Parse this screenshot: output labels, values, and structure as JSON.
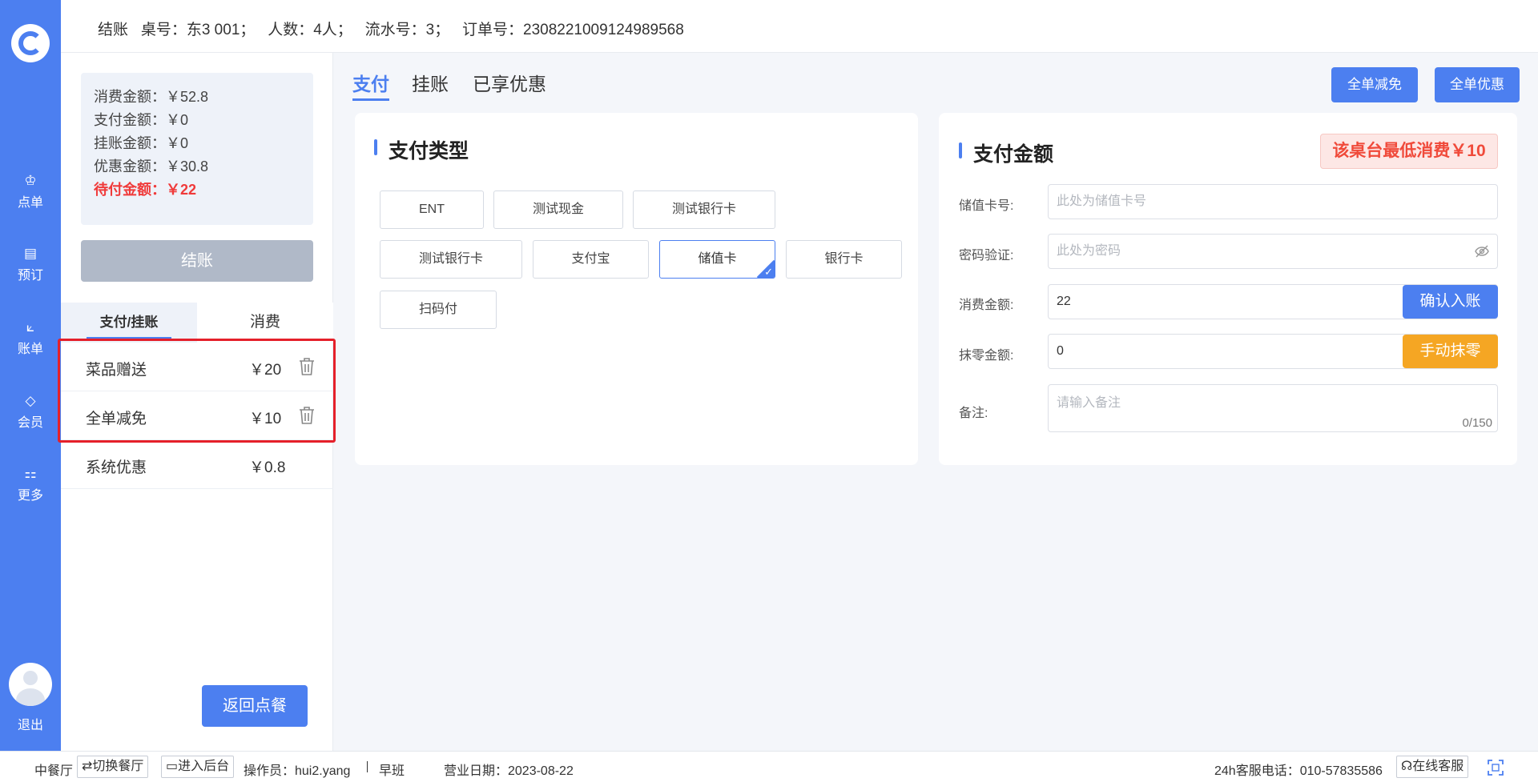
{
  "nav": {
    "items": [
      {
        "label": "点单",
        "icon": "chef-hat-icon",
        "glyph": "♔"
      },
      {
        "label": "预订",
        "icon": "booking-icon",
        "glyph": "▤"
      },
      {
        "label": "账单",
        "icon": "chart-icon",
        "glyph": "⟀"
      },
      {
        "label": "会员",
        "icon": "diamond-icon",
        "glyph": "◇"
      },
      {
        "label": "更多",
        "icon": "grid-icon",
        "glyph": "⚏"
      }
    ],
    "logout": "退出"
  },
  "header": {
    "text": "结账   桌号：东3 001；   人数：4人；   流水号：3；   订单号：2308221009124989568"
  },
  "summary": {
    "consume": "消费金额：￥52.8",
    "paid": "支付金额：￥0",
    "credit": "挂账金额：￥0",
    "discount": "优惠金额：￥30.8",
    "due": "待付金额：￥22"
  },
  "checkout_label": "结账",
  "left_tabs": {
    "pay": "支付/挂账",
    "consume": "消费"
  },
  "discounts": [
    {
      "name": "菜品赠送",
      "amount": "￥20"
    },
    {
      "name": "全单减免",
      "amount": "￥10"
    },
    {
      "name": "系统优惠",
      "amount": "￥0.8"
    }
  ],
  "back_label": "返回点餐",
  "main_tabs": [
    "支付",
    "挂账",
    "已享优惠"
  ],
  "top_buttons": {
    "full_reduce": "全单减免",
    "full_discount": "全单优惠"
  },
  "pay_type": {
    "title": "支付类型",
    "options": [
      "ENT",
      "测试现金",
      "测试银行卡",
      "测试银行卡",
      "支付宝",
      "储值卡",
      "银行卡",
      "扫码付"
    ],
    "selected": "储值卡"
  },
  "pay_amount": {
    "title": "支付金额",
    "min_consume": "该桌台最低消费￥10",
    "card_label": "储值卡号:",
    "card_placeholder": "此处为储值卡号",
    "pwd_label": "密码验证:",
    "pwd_placeholder": "此处为密码",
    "consume_label": "消费金额:",
    "consume_value": "22",
    "confirm_btn": "确认入账",
    "round_label": "抹零金额:",
    "round_value": "0",
    "round_btn": "手动抹零",
    "remark_label": "备注:",
    "remark_placeholder": "请输入备注",
    "remark_count": "0/150"
  },
  "footer": {
    "restaurant": "中餐厅",
    "switch": "切换餐厅",
    "backend": "进入后台",
    "operator": "操作员：hui2.yang",
    "shift": "早班",
    "date": "营业日期：2023-08-22",
    "hotline": "24h客服电话：010-57835586",
    "online": "在线客服"
  },
  "colors": {
    "accent": "#4c7ff0",
    "warning": "#f5a623",
    "danger": "#f03a3a",
    "disabled": "#b0b9c8"
  }
}
